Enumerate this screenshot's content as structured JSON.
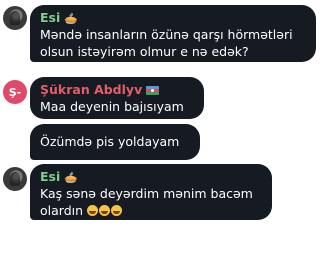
{
  "messages": [
    {
      "sender": "Esi",
      "sender_emoji": "🥧",
      "lines": [
        "Məndə insanların özünə qarşı hörmətləri",
        "olsun istəyirəm olmur e nə edək?"
      ]
    },
    {
      "sender": "Şükran Abdlyv",
      "sender_flag": "azerbaijan-flag",
      "avatar_initials": "Ş-",
      "text": "Maa deyenin bajısıyam"
    },
    {
      "text": "Özümdə pis yoldayam"
    },
    {
      "sender": "Esi",
      "sender_emoji": "🥧",
      "line1": "Kaş sənə deyərdim mənim bacəm",
      "line2_text": "olardın",
      "line2_emoji": "😂😂😂"
    }
  ],
  "colors": {
    "bubble": "#161a22",
    "esi_name": "#7fcf8a",
    "sukran_name": "#e35d6a",
    "sukran_avatar": "#e04a6a"
  }
}
